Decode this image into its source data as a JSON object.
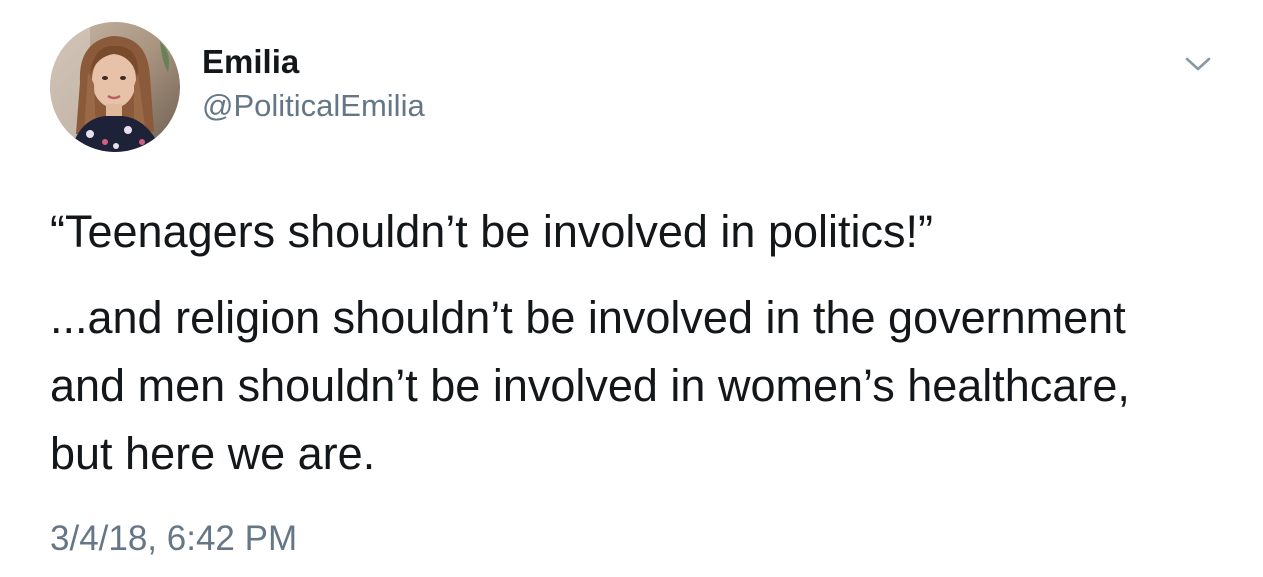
{
  "tweet": {
    "author": {
      "display_name": "Emilia",
      "handle": "@PoliticalEmilia",
      "avatar_icon": "profile-photo"
    },
    "menu_icon": "chevron-down-icon",
    "text": {
      "quote_line": "“Teenagers shouldn’t be involved in politics!”",
      "lines": [
        "...and religion shouldn’t be involved in the government",
        "and men shouldn’t be involved in women’s healthcare,",
        "but here we are."
      ]
    },
    "timestamp": "3/4/18, 6:42 PM"
  },
  "colors": {
    "primary_text": "#14171a",
    "secondary_text": "#657786",
    "background": "#ffffff"
  }
}
